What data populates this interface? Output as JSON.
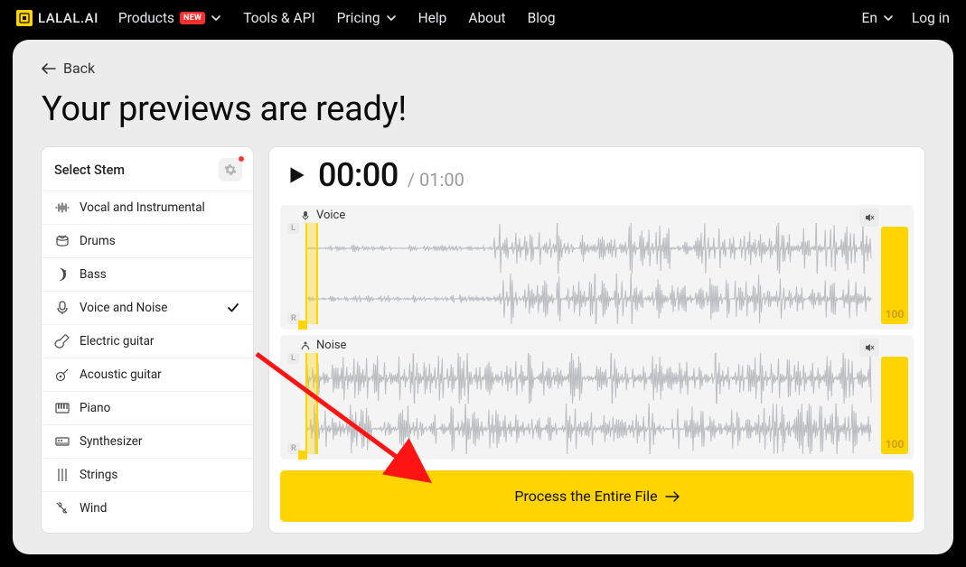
{
  "brand": "LALAL.AI",
  "nav": {
    "products": "Products",
    "products_badge": "NEW",
    "tools": "Tools & API",
    "pricing": "Pricing",
    "help": "Help",
    "about": "About",
    "blog": "Blog",
    "lang": "En",
    "login": "Log in"
  },
  "back": "Back",
  "title": "Your previews are ready!",
  "sidebar": {
    "heading": "Select Stem",
    "items": [
      {
        "label": "Vocal and Instrumental",
        "id": "vocal-instrumental"
      },
      {
        "label": "Drums",
        "id": "drums"
      },
      {
        "label": "Bass",
        "id": "bass"
      },
      {
        "label": "Voice and Noise",
        "id": "voice-noise",
        "selected": true
      },
      {
        "label": "Electric guitar",
        "id": "electric-guitar"
      },
      {
        "label": "Acoustic guitar",
        "id": "acoustic-guitar"
      },
      {
        "label": "Piano",
        "id": "piano"
      },
      {
        "label": "Synthesizer",
        "id": "synthesizer"
      },
      {
        "label": "Strings",
        "id": "strings"
      },
      {
        "label": "Wind",
        "id": "wind"
      }
    ]
  },
  "player": {
    "current": "00:00",
    "total": "/ 01:00"
  },
  "tracks": [
    {
      "label": "Voice",
      "volume": "100",
      "lr": [
        "L",
        "R"
      ]
    },
    {
      "label": "Noise",
      "volume": "100",
      "lr": [
        "L",
        "R"
      ]
    }
  ],
  "process_label": "Process the Entire File"
}
